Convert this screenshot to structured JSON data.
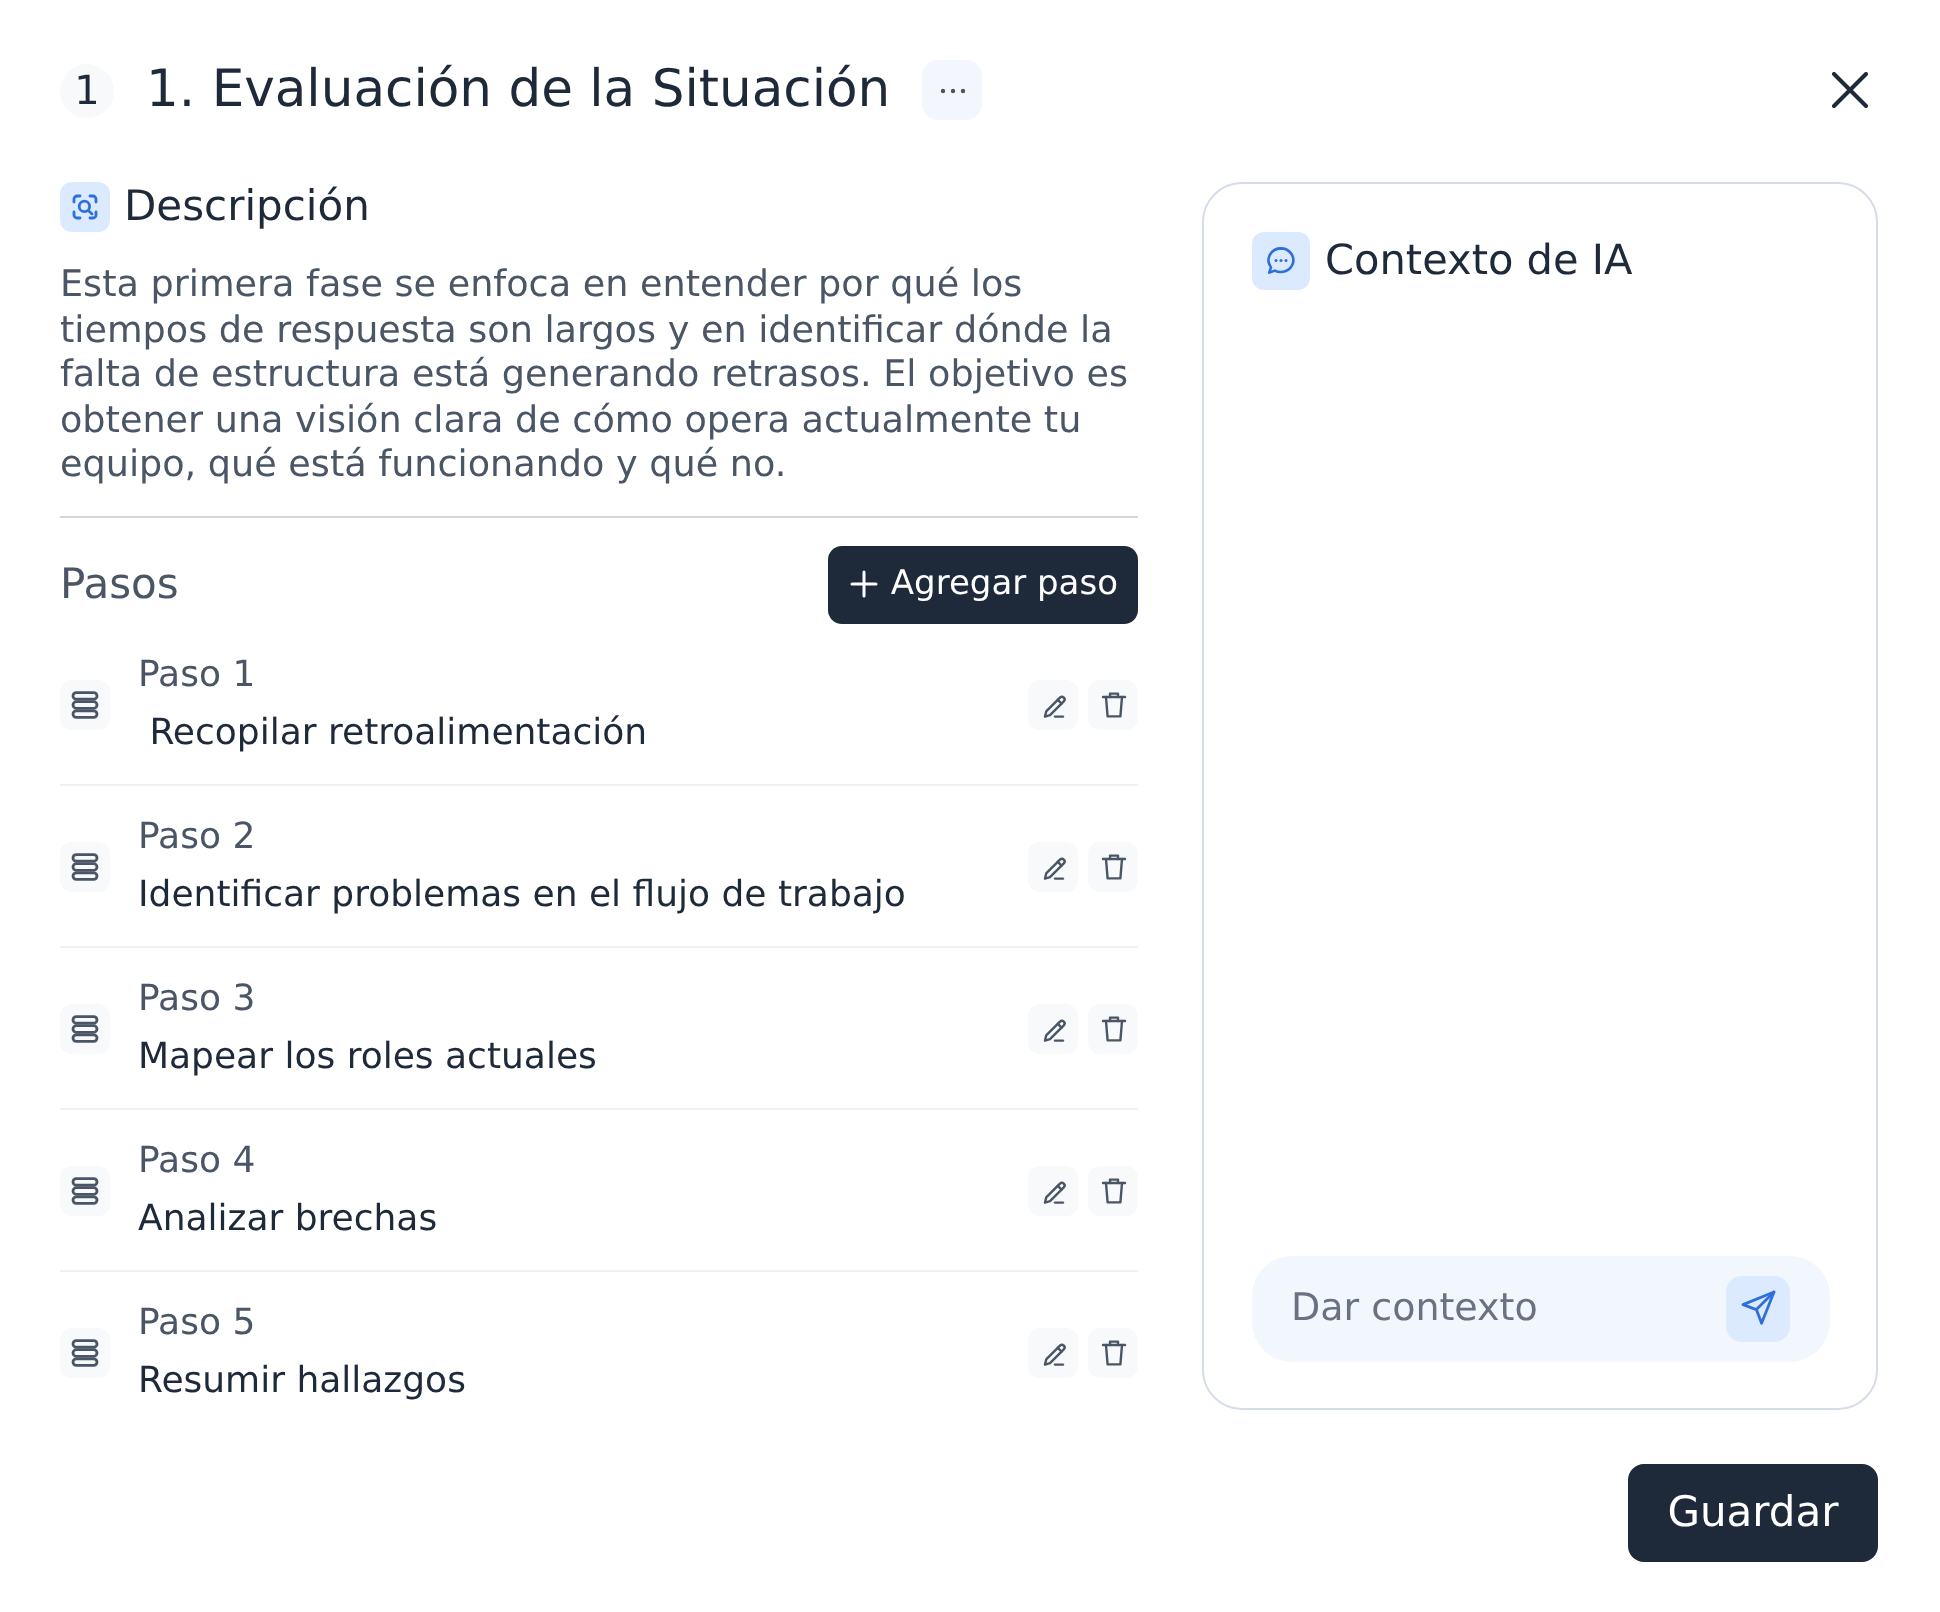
{
  "header": {
    "number": "1",
    "title": "1. Evaluación de la Situación"
  },
  "description": {
    "title": "Descripción",
    "text": "Esta primera fase se enfoca en entender por qué los tiempos de respuesta son largos y en identificar dónde la falta de estructura está generando retrasos. El objetivo es obtener una visión clara de cómo opera actualmente tu equipo, qué está funcionando y qué no."
  },
  "steps_section": {
    "title": "Pasos",
    "add_button": "Agregar paso",
    "steps": [
      {
        "label": "Paso 1",
        "title": " Recopilar retroalimentación"
      },
      {
        "label": "Paso 2",
        "title": "Identificar problemas en el flujo de trabajo"
      },
      {
        "label": "Paso 3",
        "title": "Mapear los roles actuales"
      },
      {
        "label": "Paso 4",
        "title": "Analizar brechas"
      },
      {
        "label": "Paso 5",
        "title": "Resumir hallazgos"
      }
    ]
  },
  "ai_context": {
    "title": "Contexto de IA",
    "input": {
      "placeholder": "Dar contexto"
    }
  },
  "save_button": "Guardar"
}
